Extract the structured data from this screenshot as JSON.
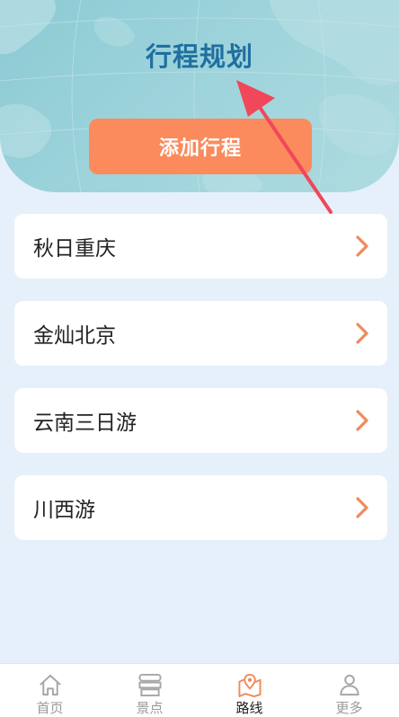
{
  "header": {
    "title": "行程规划",
    "add_button_label": "添加行程"
  },
  "trips": [
    {
      "name": "秋日重庆"
    },
    {
      "name": "金灿北京"
    },
    {
      "name": "云南三日游"
    },
    {
      "name": "川西游"
    }
  ],
  "tabbar": {
    "tabs": [
      {
        "label": "首页",
        "icon": "home-icon",
        "active": false
      },
      {
        "label": "景点",
        "icon": "attractions-icon",
        "active": false
      },
      {
        "label": "路线",
        "icon": "route-map-icon",
        "active": true
      },
      {
        "label": "更多",
        "icon": "user-icon",
        "active": false
      }
    ]
  },
  "colors": {
    "title": "#1f6fa0",
    "accent": "#fb8b5c",
    "page_background": "#e6f0fb",
    "header_background": "#9dd3db",
    "annotation_arrow": "#f0475a"
  }
}
